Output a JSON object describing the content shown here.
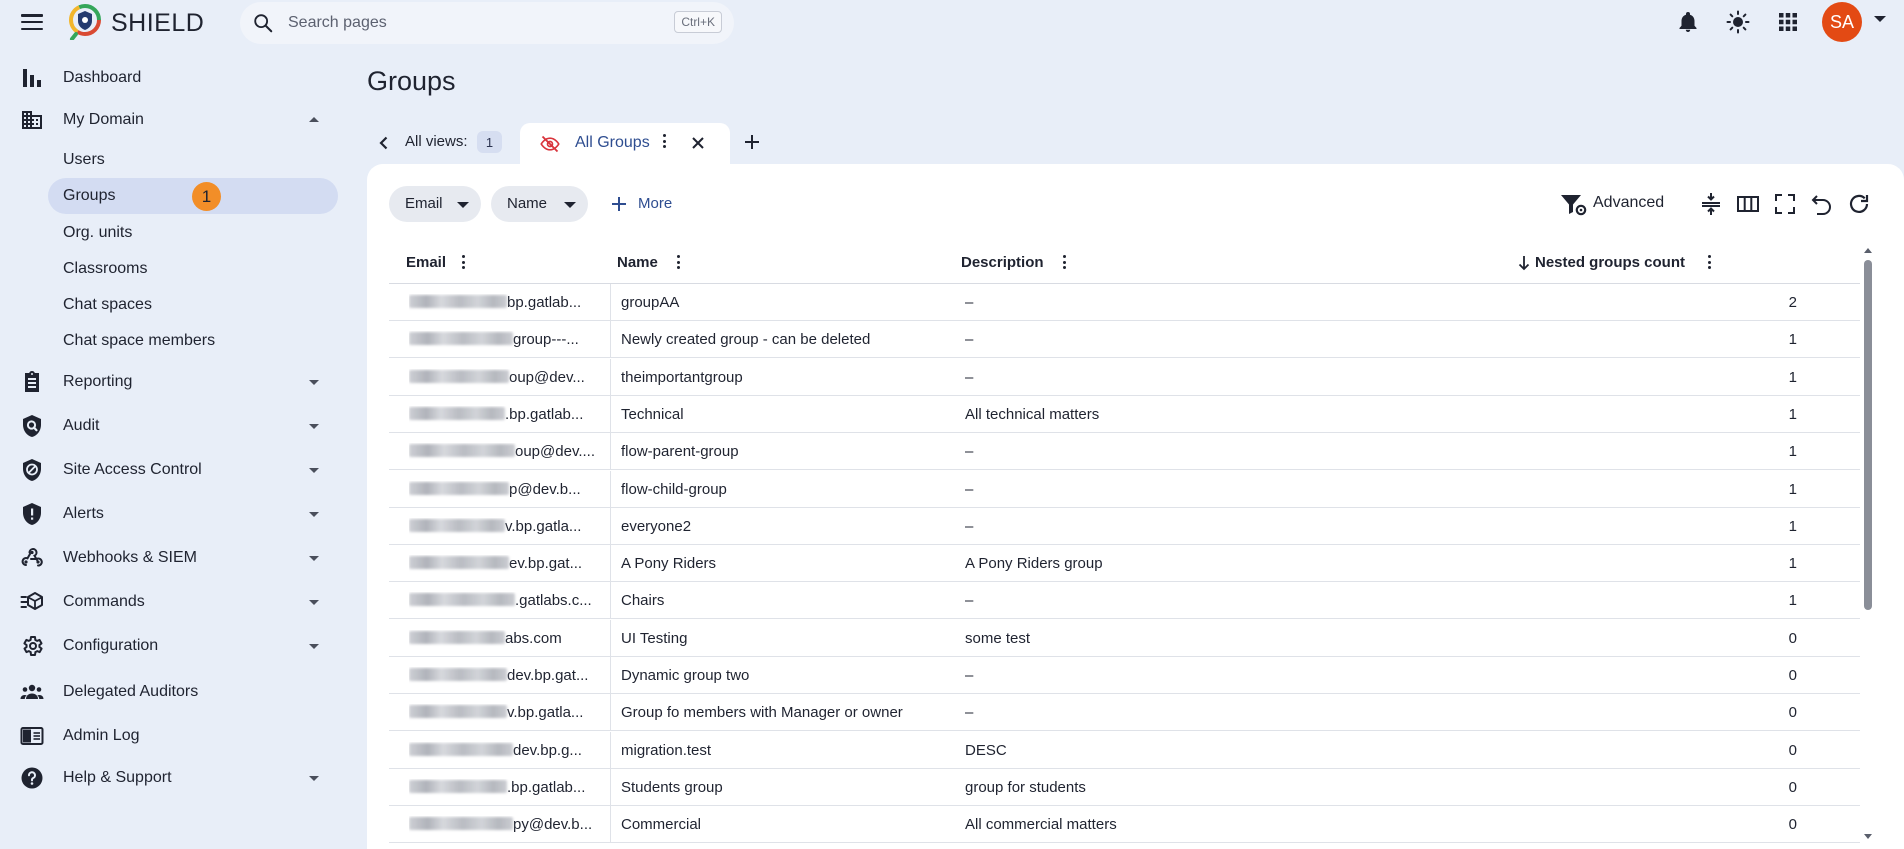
{
  "app": {
    "name": "SHIELD"
  },
  "search": {
    "placeholder": "Search pages",
    "shortcut": "Ctrl+K"
  },
  "user": {
    "initials": "SA",
    "avatar_color": "#e34a14"
  },
  "colors": {
    "accent": "#2e4d90",
    "badge": "#f28e28",
    "active_nav": "#d3dcf2",
    "page_bg": "#e8eef8"
  },
  "sidebar": {
    "items": [
      {
        "label": "Dashboard",
        "icon": "bar-chart-icon"
      },
      {
        "label": "My Domain",
        "icon": "domain-icon",
        "expanded": true
      },
      {
        "label": "Reporting",
        "icon": "clipboard-icon"
      },
      {
        "label": "Audit",
        "icon": "audit-icon"
      },
      {
        "label": "Site Access Control",
        "icon": "shield-check-icon"
      },
      {
        "label": "Alerts",
        "icon": "alert-shield-icon"
      },
      {
        "label": "Webhooks & SIEM",
        "icon": "webhook-icon"
      },
      {
        "label": "Commands",
        "icon": "commands-icon"
      },
      {
        "label": "Configuration",
        "icon": "gear-icon"
      },
      {
        "label": "Delegated Auditors",
        "icon": "people-icon"
      },
      {
        "label": "Admin Log",
        "icon": "log-icon"
      },
      {
        "label": "Help & Support",
        "icon": "help-icon"
      }
    ],
    "domain_sub_items": [
      {
        "label": "Users"
      },
      {
        "label": "Groups",
        "badge": "1",
        "active": true
      },
      {
        "label": "Org. units"
      },
      {
        "label": "Classrooms"
      },
      {
        "label": "Chat spaces"
      },
      {
        "label": "Chat space members"
      }
    ]
  },
  "page": {
    "title": "Groups"
  },
  "views": {
    "label": "All views:",
    "count": "1"
  },
  "tab": {
    "label": "All Groups"
  },
  "filters": {
    "chips": [
      {
        "label": "Email"
      },
      {
        "label": "Name"
      }
    ],
    "more_label": "More",
    "advanced_label": "Advanced"
  },
  "table": {
    "columns": [
      "Email",
      "Name",
      "Description",
      "Nested groups count"
    ],
    "sort": {
      "column": "Nested groups count",
      "direction": "descending"
    },
    "rows": [
      {
        "email": "bp.gatlab...",
        "name": "groupAA",
        "description": "–",
        "count": "2"
      },
      {
        "email": "group---...",
        "name": "Newly created group - can be deleted",
        "description": "–",
        "count": "1"
      },
      {
        "email": "oup@dev...",
        "name": "theimportantgroup",
        "description": "–",
        "count": "1"
      },
      {
        "email": ".bp.gatlab...",
        "name": "Technical",
        "description": "All technical matters",
        "count": "1"
      },
      {
        "email": "oup@dev....",
        "name": "flow-parent-group",
        "description": "–",
        "count": "1"
      },
      {
        "email": "p@dev.b...",
        "name": "flow-child-group",
        "description": "–",
        "count": "1"
      },
      {
        "email": "v.bp.gatla...",
        "name": "everyone2",
        "description": "–",
        "count": "1"
      },
      {
        "email": "ev.bp.gat...",
        "name": "A Pony Riders",
        "description": "A Pony Riders group",
        "count": "1"
      },
      {
        "email": ".gatlabs.c...",
        "name": "Chairs",
        "description": "–",
        "count": "1"
      },
      {
        "email": "abs.com",
        "name": "UI Testing",
        "description": "some test",
        "count": "0"
      },
      {
        "email": "dev.bp.gat...",
        "name": "Dynamic group two",
        "description": "–",
        "count": "0"
      },
      {
        "email": "v.bp.gatla...",
        "name": "Group fo members with Manager or owner",
        "description": "–",
        "count": "0"
      },
      {
        "email": "dev.bp.g...",
        "name": "migration.test",
        "description": "DESC",
        "count": "0"
      },
      {
        "email": ".bp.gatlab...",
        "name": "Students group",
        "description": "group for students",
        "count": "0"
      },
      {
        "email": "py@dev.b...",
        "name": "Commercial",
        "description": "All commercial matters",
        "count": "0"
      }
    ]
  }
}
